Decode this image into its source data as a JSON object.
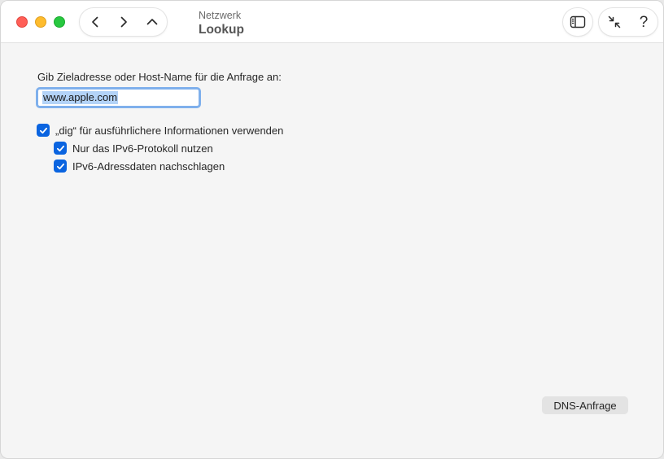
{
  "window": {
    "title_sub": "Netzwerk",
    "title_main": "Lookup"
  },
  "toolbar": {
    "back_icon": "chevron-left-icon",
    "forward_icon": "chevron-right-icon",
    "up_icon": "chevron-up-icon",
    "sidebar_icon": "sidebar-icon",
    "shrink_icon": "collapse-arrows-icon",
    "help_label": "?"
  },
  "form": {
    "prompt": "Gib Zieladresse oder Host-Name für die Anfrage an:",
    "host_value": "www.apple.com",
    "options": [
      {
        "label": "„dig“ für ausführlichere Informationen verwenden",
        "checked": true
      },
      {
        "label": "Nur das IPv6-Protokoll nutzen",
        "checked": true
      },
      {
        "label": "IPv6-Adressdaten nachschlagen",
        "checked": true
      }
    ],
    "submit_label": "DNS-Anfrage"
  },
  "colors": {
    "accent": "#0a64e0",
    "focus_ring": "#7fb0ec",
    "selection": "#b3d3f8",
    "close": "#ff5f57",
    "minimize": "#febc2e",
    "maximize": "#28c840"
  }
}
